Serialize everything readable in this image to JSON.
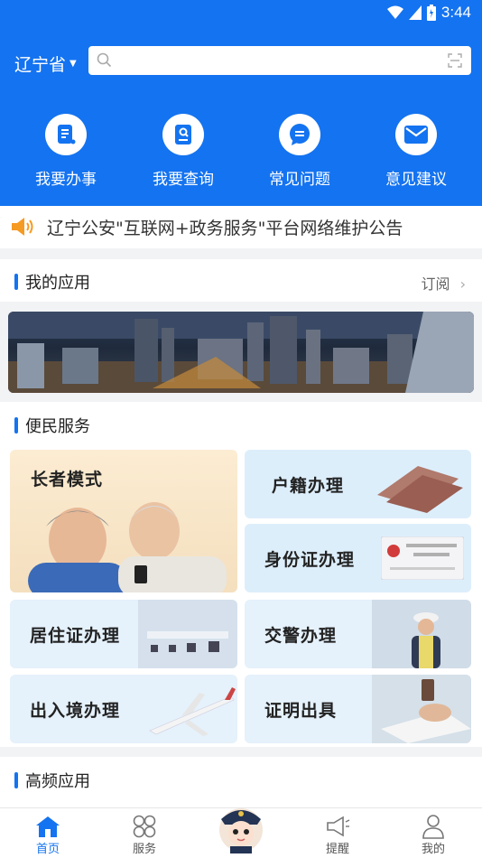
{
  "status_bar": {
    "time": "3:44"
  },
  "header": {
    "province": "辽宁省",
    "search_placeholder": ""
  },
  "quick_actions": [
    {
      "label": "我要办事",
      "icon": "document-edit-icon"
    },
    {
      "label": "我要查询",
      "icon": "search-document-icon"
    },
    {
      "label": "常见问题",
      "icon": "chat-bubble-icon"
    },
    {
      "label": "意见建议",
      "icon": "mail-icon"
    }
  ],
  "notice": {
    "text": "辽宁公安\"互联网+政务服务\"平台网络维护公告",
    "icon": "speaker-icon"
  },
  "my_apps": {
    "title": "我的应用",
    "subscribe_label": "订阅"
  },
  "convenience": {
    "title": "便民服务",
    "cards": [
      {
        "label": "长者模式"
      },
      {
        "label": "户籍办理"
      },
      {
        "label": "身份证办理"
      },
      {
        "label": "居住证办理"
      },
      {
        "label": "交警办理"
      },
      {
        "label": "出入境办理"
      },
      {
        "label": "证明出具"
      }
    ]
  },
  "high_freq": {
    "title": "高频应用"
  },
  "tabbar": [
    {
      "label": "首页",
      "icon": "home-icon",
      "active": true
    },
    {
      "label": "服务",
      "icon": "grid-icon"
    },
    {
      "label": "",
      "icon": "police-avatar-icon"
    },
    {
      "label": "提醒",
      "icon": "megaphone-icon"
    },
    {
      "label": "我的",
      "icon": "user-icon"
    }
  ],
  "colors": {
    "primary": "#1473f0",
    "background": "#f2f3f5",
    "notice_icon": "#f59a23"
  }
}
